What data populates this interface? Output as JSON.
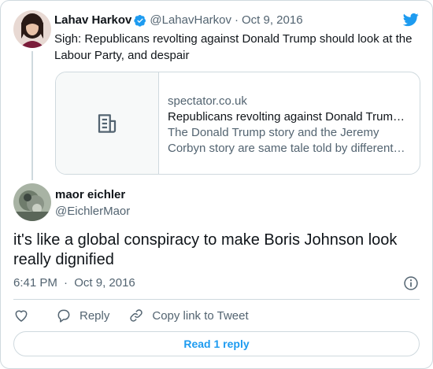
{
  "parent_tweet": {
    "author_name": "Lahav Harkov",
    "handle": "@LahavHarkov",
    "separator": "·",
    "date": "Oct 9, 2016",
    "text": "Sigh: Republicans revolting against Donald Trump should look at the Labour Party, and despair",
    "card": {
      "domain": "spectator.co.uk",
      "title": "Republicans revolting against Donald Trump should look at the Labour Party, and despair",
      "description": "The Donald Trump story and the Jeremy Corbyn story are same tale told by different narrators",
      "thumbnail_icon": "document-icon"
    }
  },
  "reply_tweet": {
    "author_name": "maor eichler",
    "handle": "@EichlerMaor",
    "text": "it's like a global conspiracy to make Boris Johnson look really dignified",
    "time": "6:41 PM",
    "separator": "·",
    "date": "Oct 9, 2016"
  },
  "actions": {
    "like_icon": "heart-icon",
    "reply_label": "Reply",
    "copy_link_label": "Copy link to Tweet"
  },
  "read_replies_label": "Read 1 reply",
  "colors": {
    "accent": "#1d9bf0",
    "text_primary": "#0f1419",
    "text_secondary": "#536471",
    "border": "#cfd9de"
  }
}
